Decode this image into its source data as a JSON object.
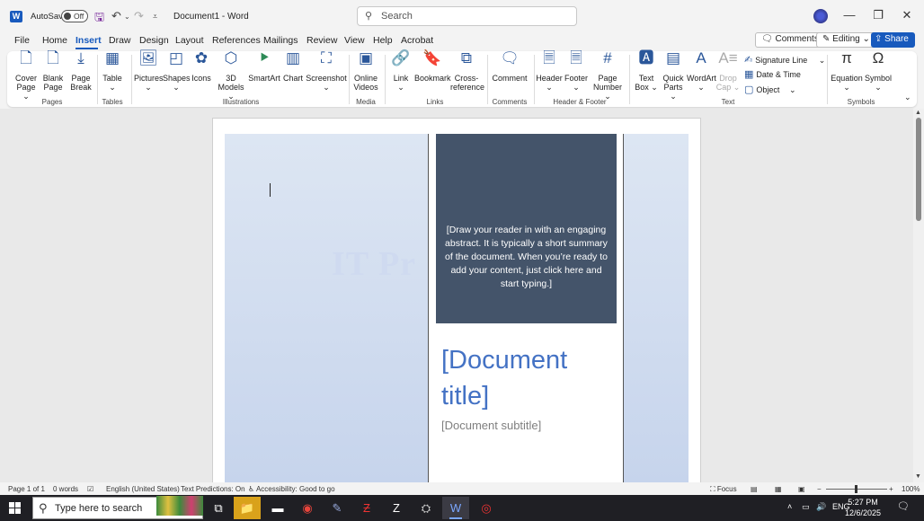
{
  "title_bar": {
    "autosave_label": "AutoSave",
    "autosave_state": "Off",
    "document_title": "Document1 - Word",
    "search_placeholder": "Search"
  },
  "menu": {
    "tabs": [
      "File",
      "Home",
      "Insert",
      "Draw",
      "Design",
      "Layout",
      "References",
      "Mailings",
      "Review",
      "View",
      "Help",
      "Acrobat"
    ],
    "active_tab": "Insert",
    "comments_label": "Comments",
    "editing_label": "Editing",
    "share_label": "Share"
  },
  "ribbon": {
    "pages": {
      "group": "Pages",
      "cover_page": "Cover Page",
      "blank_page": "Blank Page",
      "page_break": "Page Break"
    },
    "tables": {
      "group": "Tables",
      "table": "Table"
    },
    "illustrations": {
      "group": "Illustrations",
      "pictures": "Pictures",
      "shapes": "Shapes",
      "icons": "Icons",
      "models": "3D Models",
      "smartart": "SmartArt",
      "chart": "Chart",
      "screenshot": "Screenshot"
    },
    "media": {
      "group": "Media",
      "online_videos": "Online Videos"
    },
    "links": {
      "group": "Links",
      "link": "Link",
      "bookmark": "Bookmark",
      "cross_reference": "Cross-reference"
    },
    "comments": {
      "group": "Comments",
      "comment": "Comment"
    },
    "header_footer": {
      "group": "Header & Footer",
      "header": "Header",
      "footer": "Footer",
      "page_number": "Page Number"
    },
    "text": {
      "group": "Text",
      "text_box": "Text Box",
      "quick_parts": "Quick Parts",
      "wordart": "WordArt",
      "drop_cap": "Drop Cap",
      "signature_line": "Signature Line",
      "date_time": "Date & Time",
      "object": "Object"
    },
    "symbols": {
      "group": "Symbols",
      "equation": "Equation",
      "symbol": "Symbol"
    }
  },
  "document": {
    "watermark": "IT Pr",
    "abstract": "[Draw your reader in with an engaging abstract. It is typically a short summary of the document. When you’re ready to add your content, just click here and start typing.]",
    "title": "[Document title]",
    "subtitle": "[Document subtitle]"
  },
  "status_bar": {
    "page": "Page 1 of 1",
    "words": "0 words",
    "language": "English (United States)",
    "predictions": "Text Predictions: On",
    "accessibility": "Accessibility: Good to go",
    "focus": "Focus",
    "zoom": "100%"
  },
  "taskbar": {
    "search_placeholder": "Type here to search",
    "language": "ENG",
    "time": "5:27 PM",
    "date": "12/6/2025"
  },
  "colors": {
    "accent": "#185abd",
    "abstract_box": "#44546a",
    "title_blue": "#4472c4"
  }
}
